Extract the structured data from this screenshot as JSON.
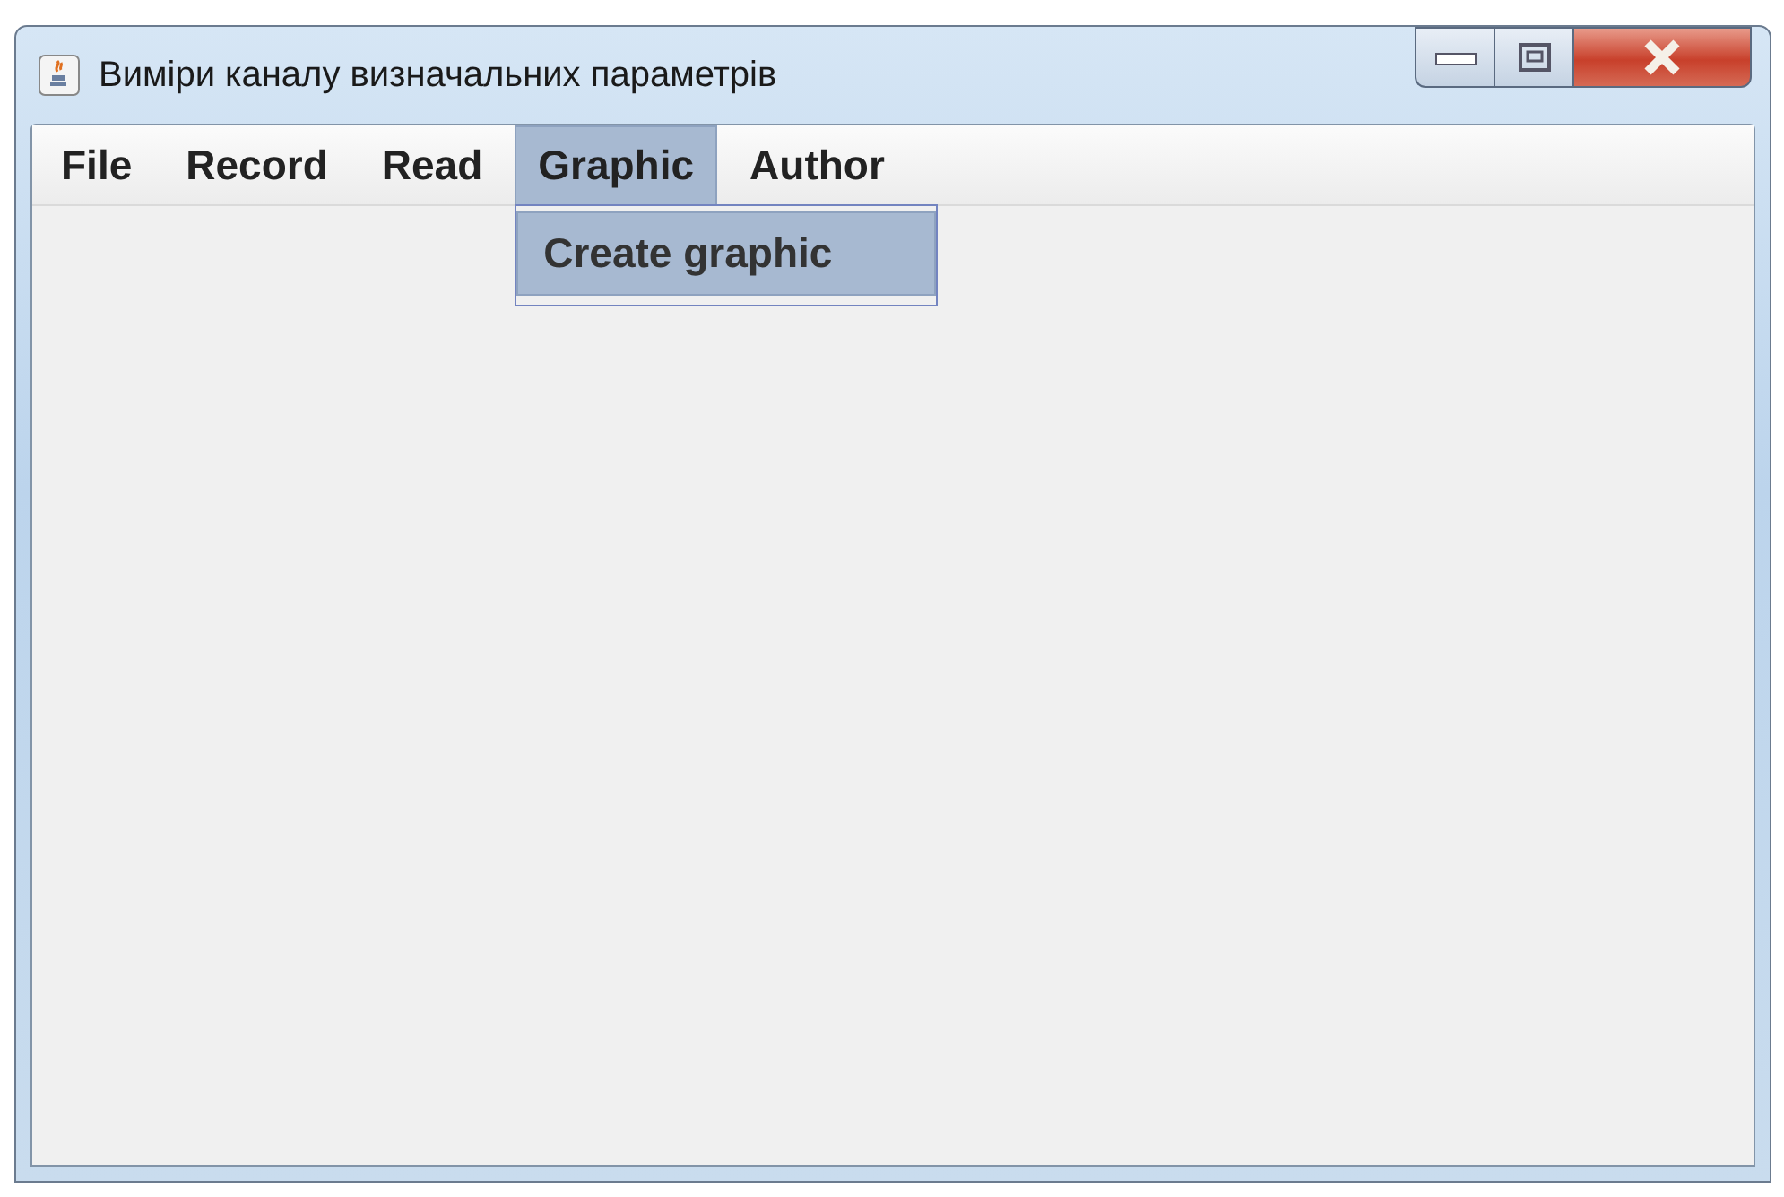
{
  "window": {
    "title": "Виміри каналу визначальних параметрів"
  },
  "menu_bar": {
    "items": [
      {
        "label": "File",
        "selected": false
      },
      {
        "label": "Record",
        "selected": false
      },
      {
        "label": "Read",
        "selected": false
      },
      {
        "label": "Graphic",
        "selected": true
      },
      {
        "label": "Author",
        "selected": false
      }
    ]
  },
  "open_menu": {
    "items": [
      {
        "label": "Create graphic",
        "selected": true
      }
    ]
  }
}
